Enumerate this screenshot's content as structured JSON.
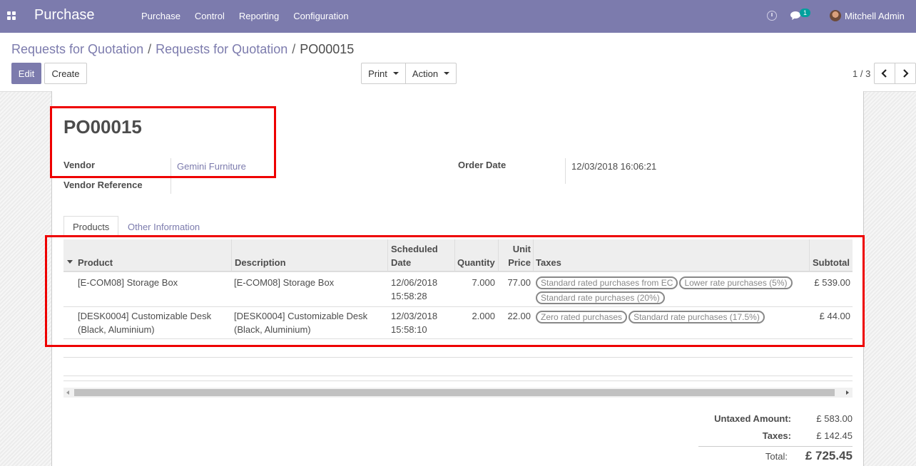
{
  "navbar": {
    "brand": "Purchase",
    "menu": [
      "Purchase",
      "Control",
      "Reporting",
      "Configuration"
    ],
    "chat_badge": "1",
    "user_name": "Mitchell Admin"
  },
  "breadcrumb": {
    "crumb1": "Requests for Quotation",
    "crumb2": "Requests for Quotation",
    "current": "PO00015",
    "sep": "/"
  },
  "buttons": {
    "edit": "Edit",
    "create": "Create",
    "print": "Print",
    "action": "Action"
  },
  "pager": {
    "value": "1 / 3"
  },
  "form": {
    "title": "PO00015",
    "vendor_label": "Vendor",
    "vendor_value": "Gemini Furniture",
    "vendor_ref_label": "Vendor Reference",
    "order_date_label": "Order Date",
    "order_date_value": "12/03/2018 16:06:21"
  },
  "tabs": [
    "Products",
    "Other Information"
  ],
  "table": {
    "headers": {
      "product": "Product",
      "description": "Description",
      "scheduled_l1": "Scheduled",
      "scheduled_l2": "Date",
      "quantity": "Quantity",
      "unit_l1": "Unit",
      "unit_l2": "Price",
      "taxes": "Taxes",
      "subtotal": "Subtotal"
    },
    "rows": [
      {
        "product": "[E-COM08] Storage Box",
        "description": "[E-COM08] Storage Box",
        "date_l1": "12/06/2018",
        "date_l2": "15:58:28",
        "quantity": "7.000",
        "unit_price": "77.00",
        "taxes": [
          "Standard rated purchases from EC",
          "Lower rate purchases (5%)",
          "Standard rate purchases (20%)"
        ],
        "subtotal": "£ 539.00"
      },
      {
        "product": "[DESK0004] Customizable Desk (Black, Aluminium)",
        "description": "[DESK0004] Customizable Desk (Black, Aluminium)",
        "date_l1": "12/03/2018",
        "date_l2": "15:58:10",
        "quantity": "2.000",
        "unit_price": "22.00",
        "taxes": [
          "Zero rated purchases",
          "Standard rate purchases (17.5%)"
        ],
        "subtotal": "£ 44.00"
      }
    ]
  },
  "totals": {
    "untaxed_label": "Untaxed Amount:",
    "untaxed_value": "£ 583.00",
    "taxes_label": "Taxes:",
    "taxes_value": "£ 142.45",
    "total_label": "Total:",
    "total_value": "£ 725.45"
  },
  "colors": {
    "brand": "#7c7bad",
    "highlight": "#ee0000",
    "badge": "#00a09d"
  }
}
